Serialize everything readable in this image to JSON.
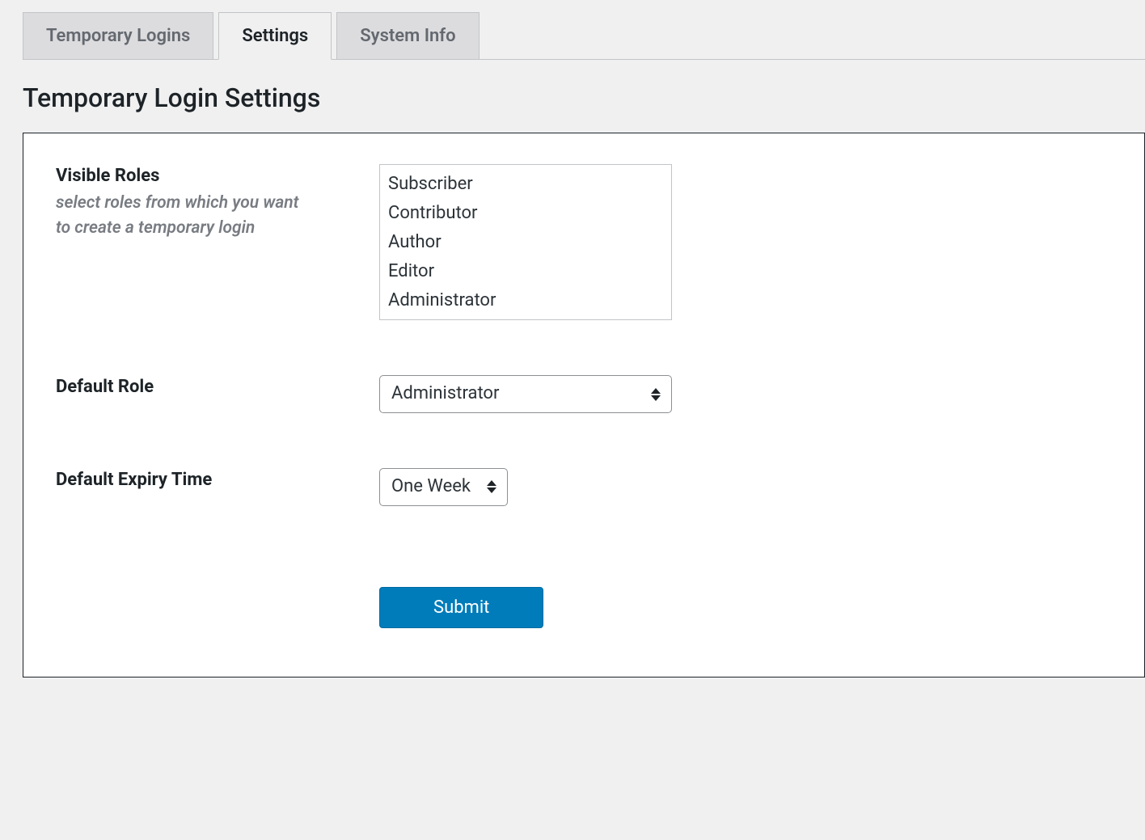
{
  "tabs": [
    {
      "label": "Temporary Logins",
      "active": false
    },
    {
      "label": "Settings",
      "active": true
    },
    {
      "label": "System Info",
      "active": false
    }
  ],
  "page_title": "Temporary Login Settings",
  "form": {
    "visible_roles": {
      "label": "Visible Roles",
      "description": "select roles from which you want to create a temporary login",
      "options": [
        "Subscriber",
        "Contributor",
        "Author",
        "Editor",
        "Administrator"
      ]
    },
    "default_role": {
      "label": "Default Role",
      "value": "Administrator"
    },
    "default_expiry": {
      "label": "Default Expiry Time",
      "value": "One Week"
    },
    "submit_label": "Submit"
  },
  "colors": {
    "primary": "#007cba",
    "bg": "#f0f0f1",
    "border": "#c3c4c7"
  }
}
